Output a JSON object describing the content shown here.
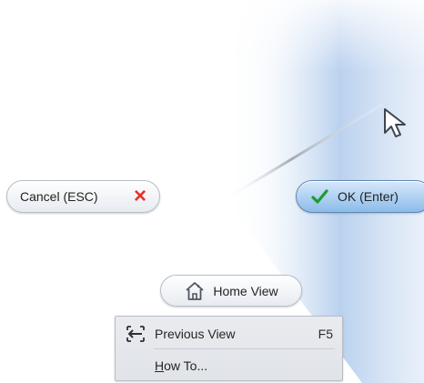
{
  "actions": {
    "cancel_label": "Cancel (ESC)",
    "ok_label": "OK (Enter)",
    "home_label": "Home View"
  },
  "context_menu": {
    "items": [
      {
        "label": "Previous View",
        "shortcut": "F5",
        "icon": "previous-view-icon"
      },
      {
        "label": "How To...",
        "icon": ""
      }
    ]
  },
  "icons": {
    "cancel": "close-icon",
    "ok": "check-icon",
    "home": "home-icon",
    "cursor": "mouse-pointer-icon"
  },
  "colors": {
    "cancel": "#e6302b",
    "ok_check": "#1f9b2f",
    "ok_button": "#9dc8ef",
    "view_gradient": "#b9d2ef"
  }
}
